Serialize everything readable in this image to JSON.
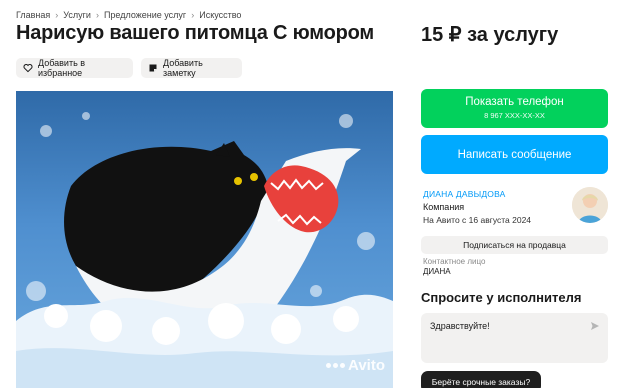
{
  "breadcrumb": [
    "Главная",
    "Услуги",
    "Предложение услуг",
    "Искусство"
  ],
  "listing": {
    "title": "Нарисую вашего питомца С юмором",
    "price": "15 ₽ за услугу"
  },
  "actions": {
    "favorite_label": "Добавить в избранное",
    "note_label": "Добавить заметку"
  },
  "photo": {
    "watermark": "Avito"
  },
  "contact_buttons": {
    "phone_label": "Показать телефон",
    "phone_masked": "8 967 XXX-XX-XX",
    "message_label": "Написать сообщение"
  },
  "seller": {
    "name": "ДИАНА ДАВЫДОВА",
    "type": "Компания",
    "since": "На Авито с 16 августа 2024",
    "subscribe_label": "Подписаться на продавца",
    "contact_label": "Контактное лицо",
    "contact_name": "ДИАНА"
  },
  "ask": {
    "title": "Спросите у исполнителя",
    "input_value": "Здравствуйте!"
  },
  "promo": {
    "urgent_label": "Берёте срочные заказы?"
  },
  "colors": {
    "phone_button": "#02d15c",
    "message_button": "#00aaff",
    "seller_link": "#0099f7",
    "chip_bg": "#f2f1f0"
  },
  "icons": [
    "heart-icon",
    "note-icon",
    "send-icon",
    "avito-logo-icon"
  ]
}
